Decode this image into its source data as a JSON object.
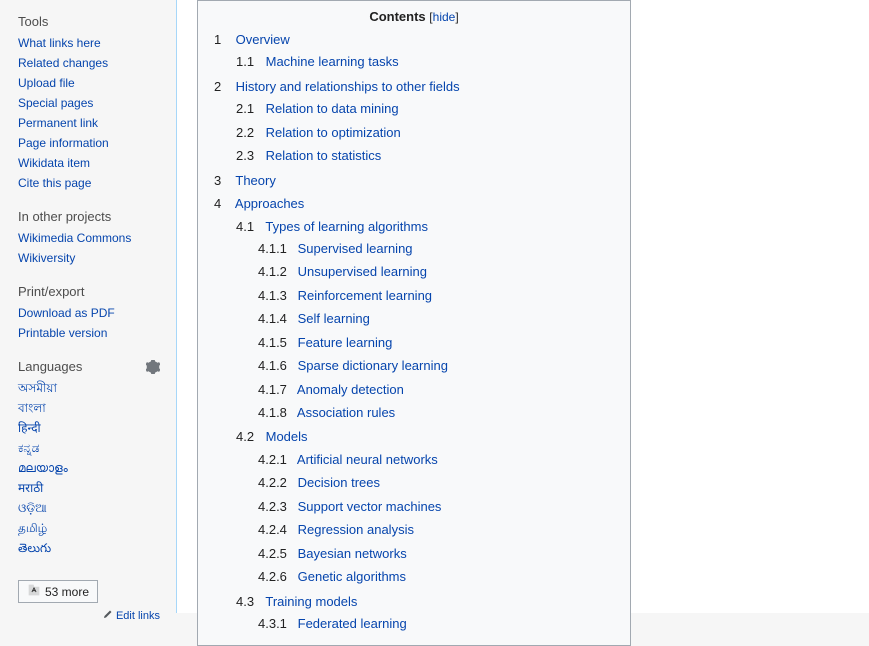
{
  "sidebar": {
    "tools": {
      "heading": "Tools",
      "items": [
        "What links here",
        "Related changes",
        "Upload file",
        "Special pages",
        "Permanent link",
        "Page information",
        "Wikidata item",
        "Cite this page"
      ]
    },
    "projects": {
      "heading": "In other projects",
      "items": [
        "Wikimedia Commons",
        "Wikiversity"
      ]
    },
    "print": {
      "heading": "Print/export",
      "items": [
        "Download as PDF",
        "Printable version"
      ]
    },
    "languages": {
      "heading": "Languages",
      "items": [
        "অসমীয়া",
        "বাংলা",
        "हिन्दी",
        "ಕನ್ನಡ",
        "മലയാളം",
        "मराठी",
        "ଓଡ଼ିଆ",
        "தமிழ்",
        "తెలుగు"
      ],
      "more_label": "53 more",
      "edit_links": "Edit links"
    }
  },
  "toc": {
    "title": "Contents",
    "toggle": "hide",
    "items": [
      {
        "n": "1",
        "t": "Overview",
        "c": [
          {
            "n": "1.1",
            "t": "Machine learning tasks"
          }
        ]
      },
      {
        "n": "2",
        "t": "History and relationships to other fields",
        "c": [
          {
            "n": "2.1",
            "t": "Relation to data mining"
          },
          {
            "n": "2.2",
            "t": "Relation to optimization"
          },
          {
            "n": "2.3",
            "t": "Relation to statistics"
          }
        ]
      },
      {
        "n": "3",
        "t": "Theory"
      },
      {
        "n": "4",
        "t": "Approaches",
        "c": [
          {
            "n": "4.1",
            "t": "Types of learning algorithms",
            "c": [
              {
                "n": "4.1.1",
                "t": "Supervised learning"
              },
              {
                "n": "4.1.2",
                "t": "Unsupervised learning"
              },
              {
                "n": "4.1.3",
                "t": "Reinforcement learning"
              },
              {
                "n": "4.1.4",
                "t": "Self learning"
              },
              {
                "n": "4.1.5",
                "t": "Feature learning"
              },
              {
                "n": "4.1.6",
                "t": "Sparse dictionary learning"
              },
              {
                "n": "4.1.7",
                "t": "Anomaly detection"
              },
              {
                "n": "4.1.8",
                "t": "Association rules"
              }
            ]
          },
          {
            "n": "4.2",
            "t": "Models",
            "c": [
              {
                "n": "4.2.1",
                "t": "Artificial neural networks"
              },
              {
                "n": "4.2.2",
                "t": "Decision trees"
              },
              {
                "n": "4.2.3",
                "t": "Support vector machines"
              },
              {
                "n": "4.2.4",
                "t": "Regression analysis"
              },
              {
                "n": "4.2.5",
                "t": "Bayesian networks"
              },
              {
                "n": "4.2.6",
                "t": "Genetic algorithms"
              }
            ]
          },
          {
            "n": "4.3",
            "t": "Training models",
            "c": [
              {
                "n": "4.3.1",
                "t": "Federated learning"
              }
            ]
          }
        ]
      }
    ]
  }
}
